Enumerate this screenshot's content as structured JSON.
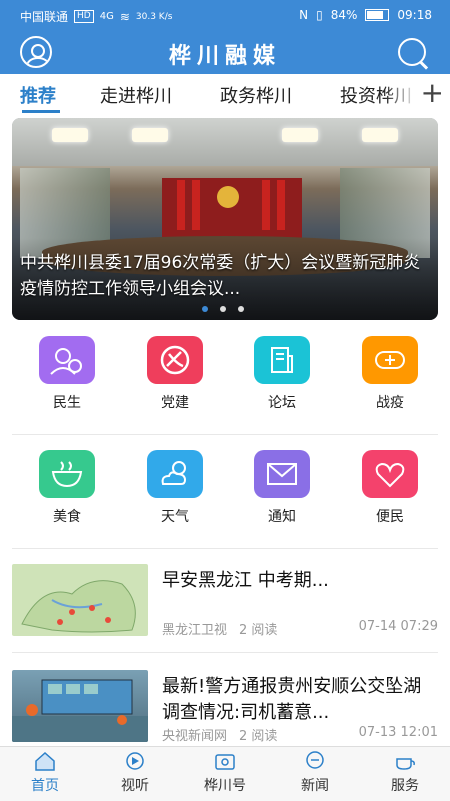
{
  "status_bar": {
    "carrier": "中国联通",
    "hd": "HD",
    "net": "4G",
    "speed": "30.3 K/s",
    "battery": "84%",
    "time": "09:18"
  },
  "app": {
    "title": "桦川融媒"
  },
  "tabs": [
    {
      "label": "推荐"
    },
    {
      "label": "走进桦川"
    },
    {
      "label": "政务桦川"
    },
    {
      "label": "投资桦川"
    }
  ],
  "add_tab": "+",
  "banner": {
    "title": "中共桦川县委17届96次常委（扩大）会议暨新冠肺炎疫情防控工作领导小组会议..."
  },
  "grid": [
    {
      "label": "民生",
      "icon": "people-icon",
      "color": "#a26cf0"
    },
    {
      "label": "党建",
      "icon": "party-emblem-icon",
      "color": "#ef3e5c"
    },
    {
      "label": "论坛",
      "icon": "forum-icon",
      "color": "#1bc3d6"
    },
    {
      "label": "战疫",
      "icon": "fight-epidemic-icon",
      "color": "#ff9800"
    },
    {
      "label": "美食",
      "icon": "food-bowl-icon",
      "color": "#36c98e"
    },
    {
      "label": "天气",
      "icon": "weather-icon",
      "color": "#31a9ea"
    },
    {
      "label": "通知",
      "icon": "mail-icon",
      "color": "#8a6fe6"
    },
    {
      "label": "便民",
      "icon": "heart-icon",
      "color": "#f4426c"
    }
  ],
  "news": [
    {
      "title": "早安黑龙江 中考期...",
      "source": "黑龙江卫视",
      "reads": "2 阅读",
      "time": "07-14 07:29"
    },
    {
      "title": "最新!警方通报贵州安顺公交坠湖调查情况:司机蓄意...",
      "source": "央视新闻网",
      "reads": "2 阅读",
      "time": "07-13 12:01"
    }
  ],
  "bottom_nav": [
    {
      "label": "首页",
      "icon": "home-icon"
    },
    {
      "label": "视听",
      "icon": "video-icon"
    },
    {
      "label": "桦川号",
      "icon": "account-icon"
    },
    {
      "label": "新闻",
      "icon": "news-icon"
    },
    {
      "label": "服务",
      "icon": "service-icon"
    }
  ],
  "colors": {
    "primary": "#3d8ad6",
    "active_tab": "#2c80c9"
  }
}
